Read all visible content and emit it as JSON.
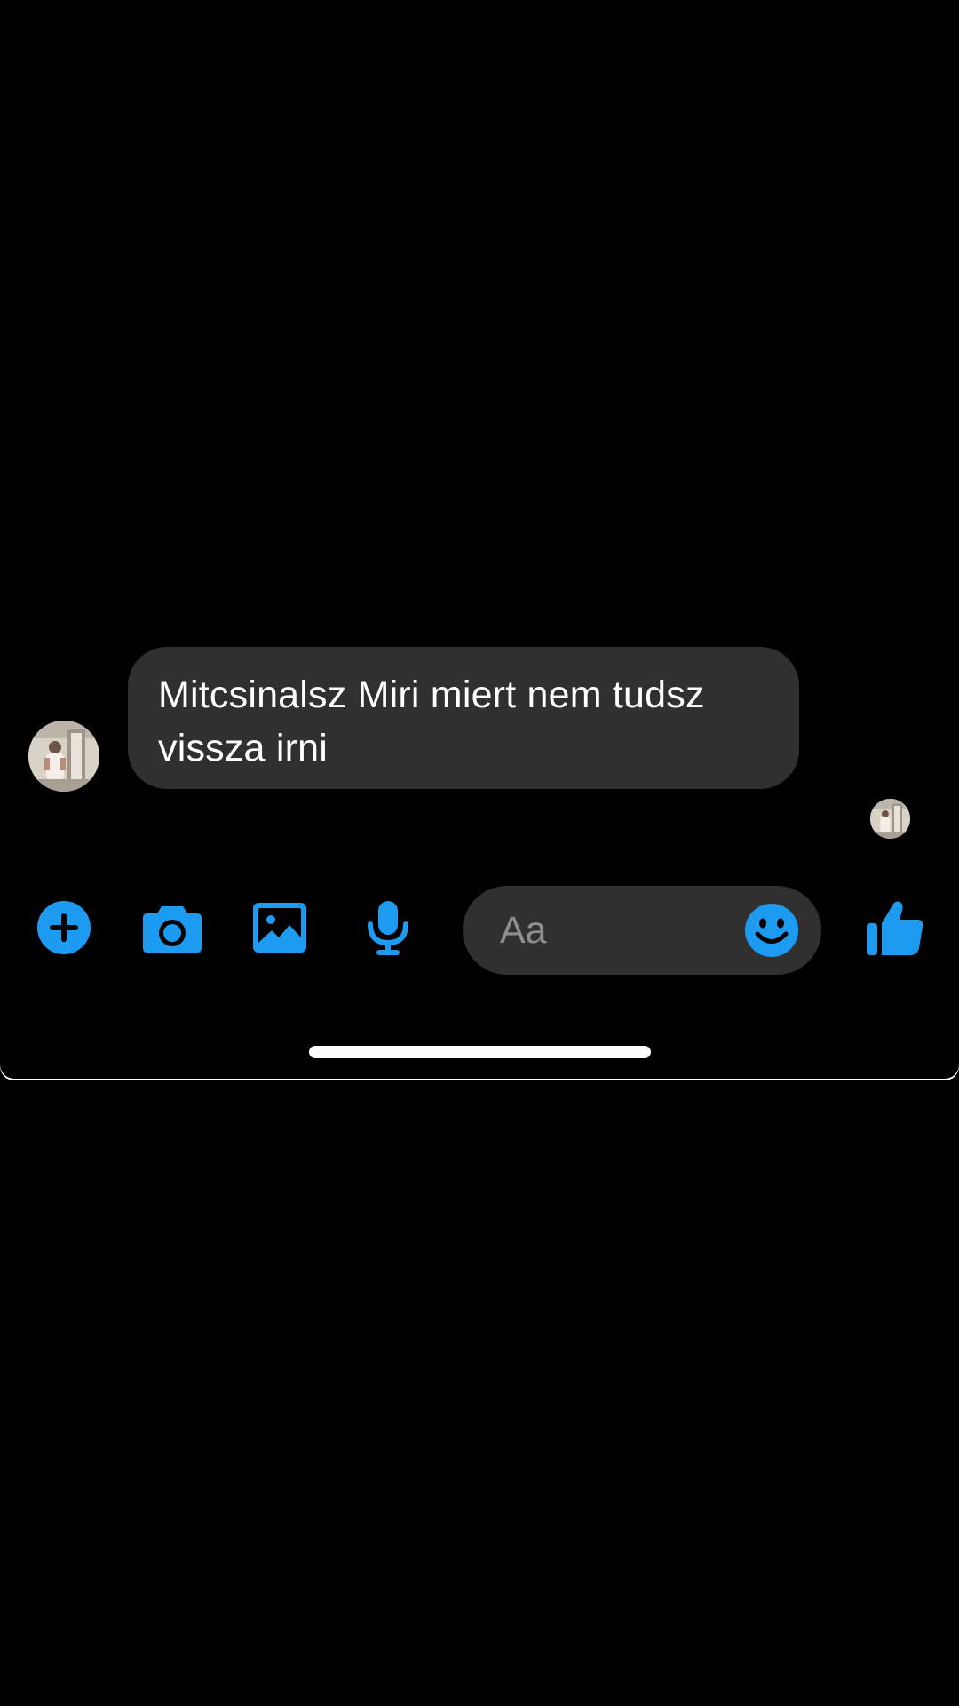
{
  "conversation": {
    "messages": [
      {
        "sender": "other",
        "text": "Mitcsinalsz Miri miert nem tudsz vissza irni"
      }
    ]
  },
  "composer": {
    "placeholder": "Aa",
    "icons": [
      "plus-icon",
      "camera-icon",
      "image-icon",
      "microphone-icon",
      "smiley-icon",
      "thumbs-up-icon"
    ]
  },
  "colors": {
    "background": "#000000",
    "bubble": "#303030",
    "accent": "#1d9bf0",
    "message_text": "#ffffff",
    "placeholder_text": "#8e8e8e"
  }
}
